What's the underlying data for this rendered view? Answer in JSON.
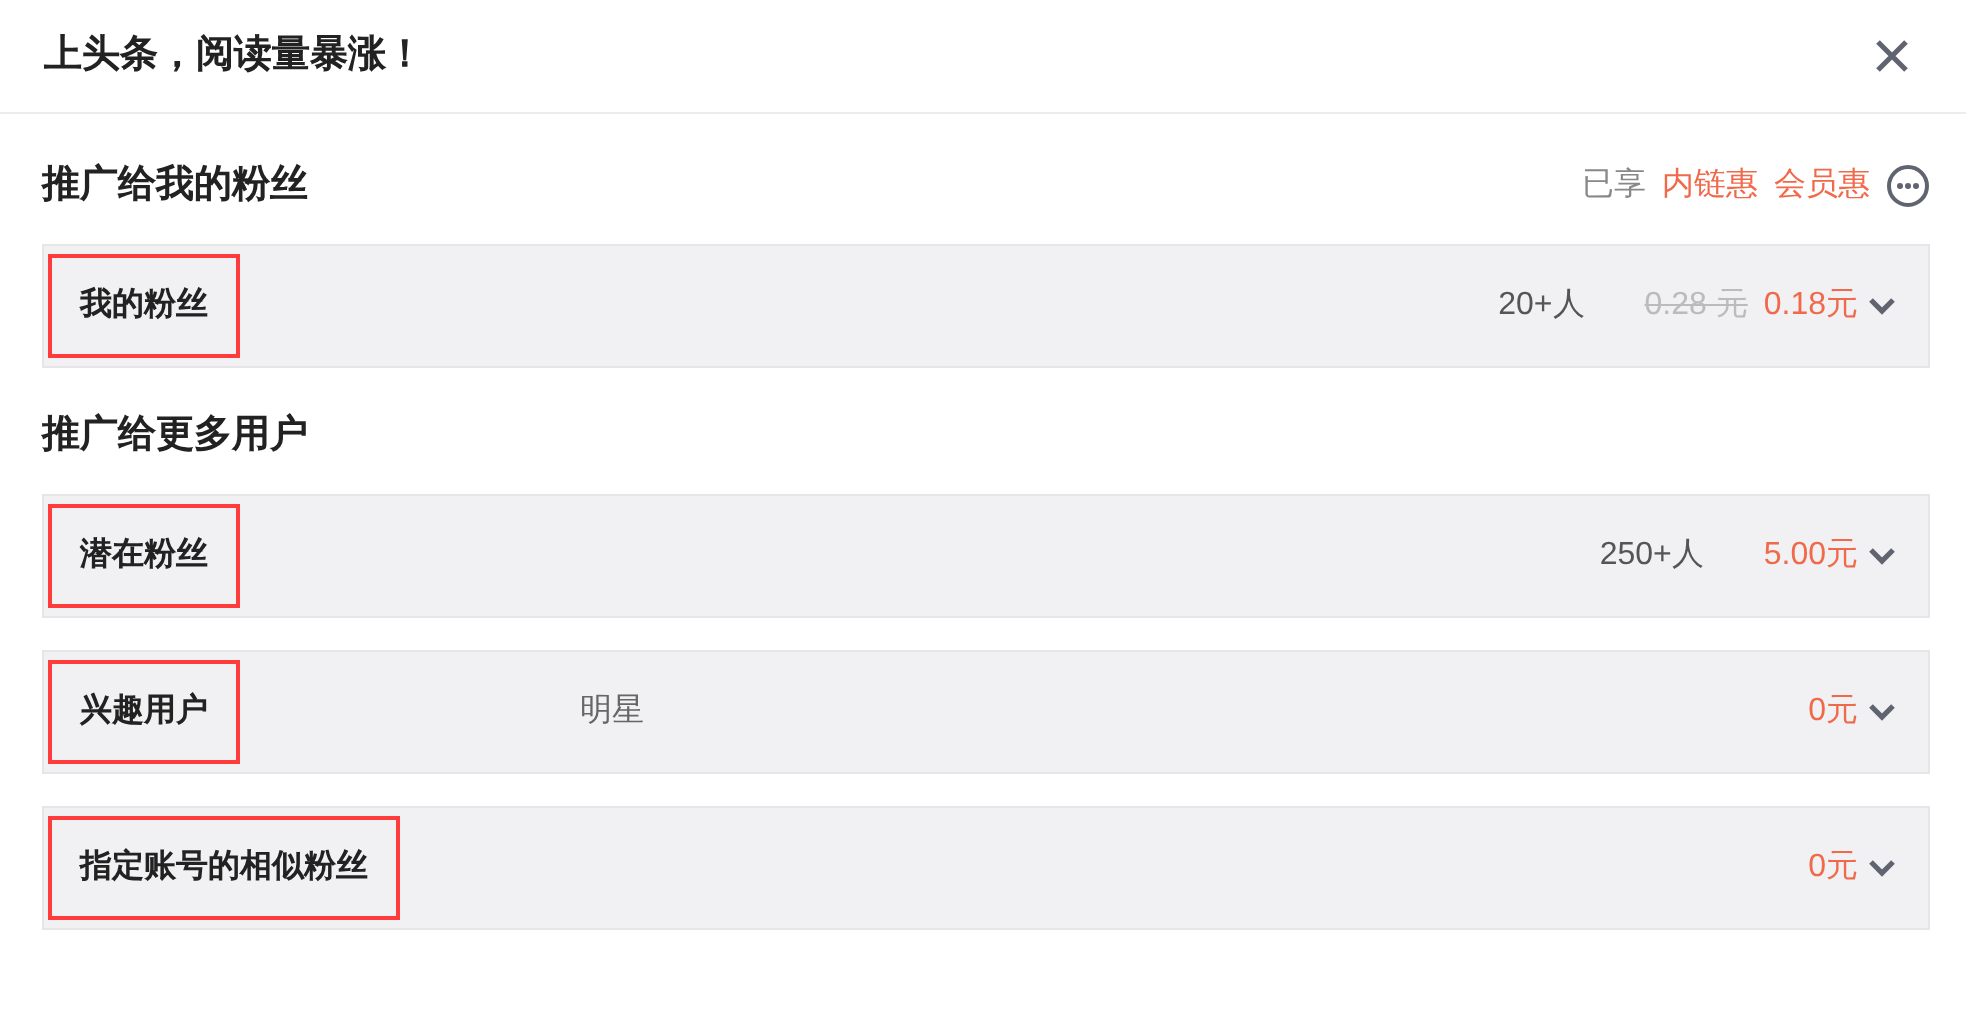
{
  "dialog": {
    "title": "上头条，阅读量暴涨！"
  },
  "sections": [
    {
      "title": "推广给我的粉丝",
      "perks": {
        "prefix": "已享",
        "items": [
          "内链惠",
          "会员惠"
        ]
      },
      "rows": [
        {
          "label": "我的粉丝",
          "highlighted": true,
          "count": "20+人",
          "original_price": "0.28 元",
          "price": "0.18元"
        }
      ]
    },
    {
      "title": "推广给更多用户",
      "rows": [
        {
          "label": "潜在粉丝",
          "highlighted": true,
          "count": "250+人",
          "price": "5.00元"
        },
        {
          "label": "兴趣用户",
          "highlighted": true,
          "tag": "明星",
          "price": "0元"
        },
        {
          "label": "指定账号的相似粉丝",
          "highlighted": true,
          "price": "0元"
        }
      ]
    }
  ]
}
